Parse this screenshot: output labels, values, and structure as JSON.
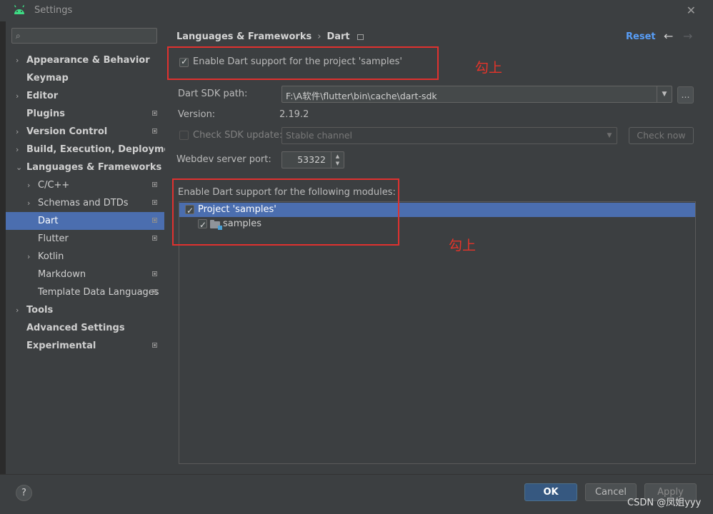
{
  "window": {
    "title": "Settings"
  },
  "sidebar": {
    "search_placeholder": "",
    "items": [
      {
        "label": "Appearance & Behavior",
        "chevron": "›",
        "bold": true,
        "mark": false
      },
      {
        "label": "Keymap",
        "chevron": "",
        "bold": true,
        "mark": false
      },
      {
        "label": "Editor",
        "chevron": "›",
        "bold": true,
        "mark": false
      },
      {
        "label": "Plugins",
        "chevron": "",
        "bold": true,
        "mark": true
      },
      {
        "label": "Version Control",
        "chevron": "›",
        "bold": true,
        "mark": true
      },
      {
        "label": "Build, Execution, Deployment",
        "chevron": "›",
        "bold": true,
        "mark": false
      },
      {
        "label": "Languages & Frameworks",
        "chevron": "⌄",
        "bold": true,
        "mark": false
      },
      {
        "label": "C/C++",
        "chevron": "›",
        "bold": false,
        "mark": true
      },
      {
        "label": "Schemas and DTDs",
        "chevron": "›",
        "bold": false,
        "mark": true
      },
      {
        "label": "Dart",
        "chevron": "",
        "bold": false,
        "mark": true,
        "selected": true
      },
      {
        "label": "Flutter",
        "chevron": "",
        "bold": false,
        "mark": true
      },
      {
        "label": "Kotlin",
        "chevron": "›",
        "bold": false,
        "mark": false
      },
      {
        "label": "Markdown",
        "chevron": "",
        "bold": false,
        "mark": true
      },
      {
        "label": "Template Data Languages",
        "chevron": "",
        "bold": false,
        "mark": true
      },
      {
        "label": "Tools",
        "chevron": "›",
        "bold": true,
        "mark": false
      },
      {
        "label": "Advanced Settings",
        "chevron": "",
        "bold": true,
        "mark": false
      },
      {
        "label": "Experimental",
        "chevron": "",
        "bold": true,
        "mark": true
      }
    ]
  },
  "breadcrumb": {
    "parent": "Languages & Frameworks",
    "separator": "›",
    "current": "Dart"
  },
  "header": {
    "reset_label": "Reset",
    "back_arrow": "←",
    "forward_arrow": "→"
  },
  "dart": {
    "enable_label": "Enable Dart support for the project 'samples'",
    "sdk_path_label": "Dart SDK path:",
    "sdk_path_value": "F:\\A软件\\flutter\\bin\\cache\\dart-sdk",
    "browse_label": "...",
    "version_label": "Version:",
    "version_value": "2.19.2",
    "check_update_label": "Check SDK update:",
    "channel_value": "Stable channel",
    "check_now_label": "Check now",
    "webdev_label": "Webdev server port:",
    "webdev_value": "53322",
    "modules_label": "Enable Dart support for the following modules:",
    "tree": [
      {
        "label": "Project 'samples'"
      },
      {
        "label": "samples"
      }
    ]
  },
  "annotations": [
    "勾上",
    "勾上"
  ],
  "annotation_color": "#e0312f",
  "footer": {
    "help": "?",
    "ok": "OK",
    "cancel": "Cancel",
    "apply": "Apply"
  },
  "watermark": "CSDN @凤姐yyy",
  "accent": "#4b6eaf"
}
